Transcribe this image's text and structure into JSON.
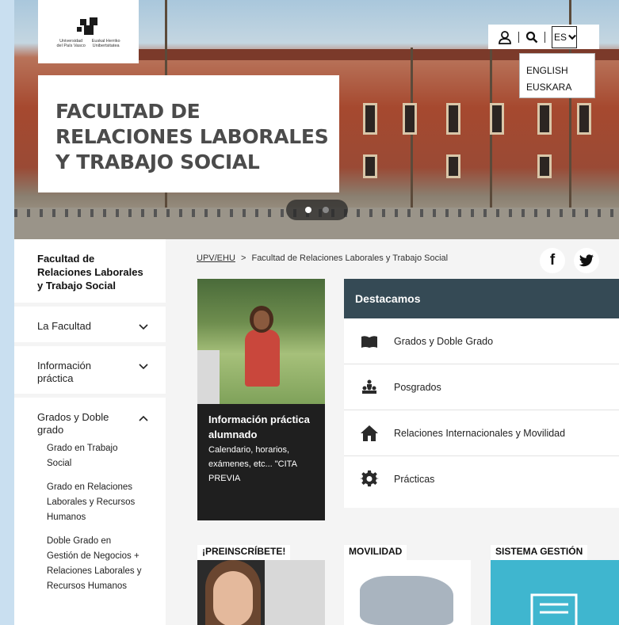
{
  "logo": {
    "line1_left": "Universidad",
    "line2_left": "del País Vasco",
    "line1_right": "Euskal Herriko",
    "line2_right": "Unibertsitatea"
  },
  "hero": {
    "title": "FACULTAD DE\nRELACIONES LABORALES\nY TRABAJO SOCIAL"
  },
  "toolbar": {
    "language_selected": "ES",
    "language_options": [
      "ENGLISH",
      "EUSKARA"
    ]
  },
  "sidebar": {
    "title": "Facultad de Relaciones Laborales y Trabajo Social",
    "items": [
      {
        "label": "La Facultad",
        "expanded": false
      },
      {
        "label": "Información práctica",
        "expanded": false
      },
      {
        "label": "Grados y Doble grado",
        "expanded": true
      }
    ],
    "subitems": [
      "Grado en Trabajo Social",
      "Grado en Relaciones Laborales y Recursos Humanos",
      "Doble Grado en Gestión de Negocios + Relaciones Laborales y Recursos Humanos"
    ]
  },
  "breadcrumb": {
    "root": "UPV/EHU",
    "separator": ">",
    "current": "Facultad de Relaciones Laborales y Trabajo Social"
  },
  "social": {
    "facebook": "f",
    "twitter": "twitter-icon"
  },
  "info_card": {
    "heading": "Información práctica alumnado",
    "text": "Calendario, horarios, exámenes, etc... \"CITA PREVIA"
  },
  "destacamos": {
    "heading": "Destacamos",
    "items": [
      {
        "label": "Grados y Doble Grado",
        "icon": "book-icon"
      },
      {
        "label": "Posgrados",
        "icon": "people-icon"
      },
      {
        "label": "Relaciones Internacionales y Movilidad",
        "icon": "house-icon"
      },
      {
        "label": "Prácticas",
        "icon": "gear-icon"
      }
    ]
  },
  "tiles": [
    {
      "label": "¡PREINSCRÍBETE!"
    },
    {
      "label": "MOVILIDAD"
    },
    {
      "label": "SISTEMA GESTIÓN"
    }
  ],
  "colors": {
    "destacamos_header": "#354a55",
    "info_card_bg": "#1f1f1f",
    "page_bg": "#c9dff0"
  }
}
